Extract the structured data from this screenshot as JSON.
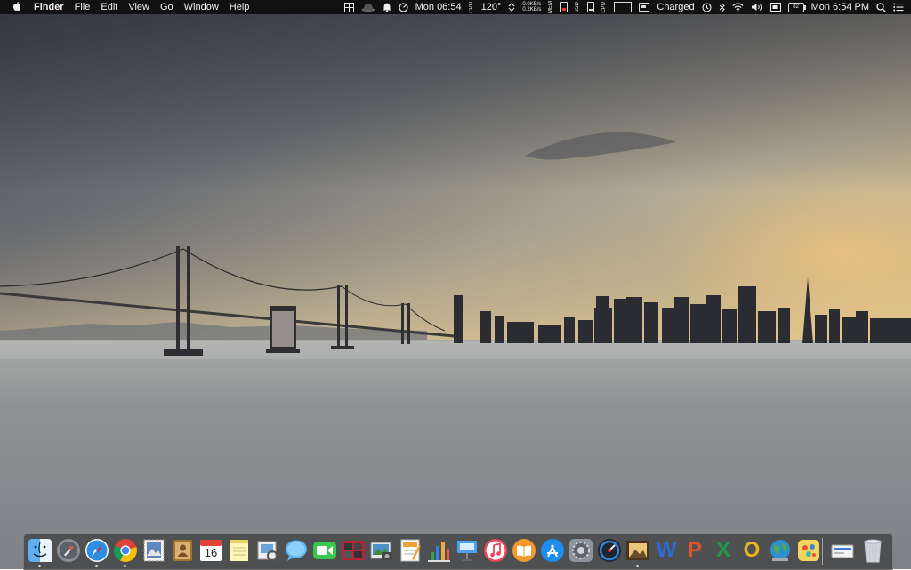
{
  "menubar": {
    "apple": "",
    "app_name": "Finder",
    "menus": [
      "File",
      "Edit",
      "View",
      "Go",
      "Window",
      "Help"
    ],
    "status": {
      "clock_short": "Mon 06:54",
      "cpu_label": "CPU",
      "temperature": "120°",
      "net_up": "0.0KB/s",
      "net_down": "0.2KB/s",
      "mem_label": "MEM",
      "ssd_label": "SSD",
      "cpu2_label": "CPU",
      "battery_status": "Charged",
      "battery_percent": "82",
      "datetime": "Mon 6:54 PM"
    }
  },
  "dock": {
    "apps": [
      {
        "name": "Finder",
        "running": true
      },
      {
        "name": "Launchpad",
        "running": false
      },
      {
        "name": "Safari",
        "running": true
      },
      {
        "name": "Google Chrome",
        "running": true
      },
      {
        "name": "Mail Stamp",
        "running": false
      },
      {
        "name": "Contacts",
        "running": false
      },
      {
        "name": "Calendar",
        "running": false,
        "date": "16"
      },
      {
        "name": "Notes",
        "running": false
      },
      {
        "name": "Preview",
        "running": false
      },
      {
        "name": "Messages",
        "running": false
      },
      {
        "name": "FaceTime",
        "running": false
      },
      {
        "name": "Photo Booth",
        "running": false
      },
      {
        "name": "Image Capture",
        "running": false
      },
      {
        "name": "Pages",
        "running": false
      },
      {
        "name": "Numbers",
        "running": false
      },
      {
        "name": "Keynote",
        "running": false
      },
      {
        "name": "iTunes",
        "running": false
      },
      {
        "name": "iBooks",
        "running": false
      },
      {
        "name": "App Store",
        "running": false
      },
      {
        "name": "System Preferences",
        "running": false
      },
      {
        "name": "Dashboard",
        "running": false
      },
      {
        "name": "Photos",
        "running": true
      },
      {
        "name": "Word",
        "running": false,
        "letter": "W"
      },
      {
        "name": "PowerPoint",
        "running": false,
        "letter": "P"
      },
      {
        "name": "Excel",
        "running": false,
        "letter": "X"
      },
      {
        "name": "Outlook",
        "running": false,
        "letter": "O"
      },
      {
        "name": "Network",
        "running": false
      },
      {
        "name": "Games",
        "running": false
      }
    ],
    "downloads_stack": "Downloads",
    "trash": "Trash"
  },
  "colors": {
    "menubar_bg": "#111111",
    "word": "#2b6cd8",
    "powerpoint": "#e0532a",
    "excel": "#1f9a49",
    "outlook": "#e8b51f"
  }
}
